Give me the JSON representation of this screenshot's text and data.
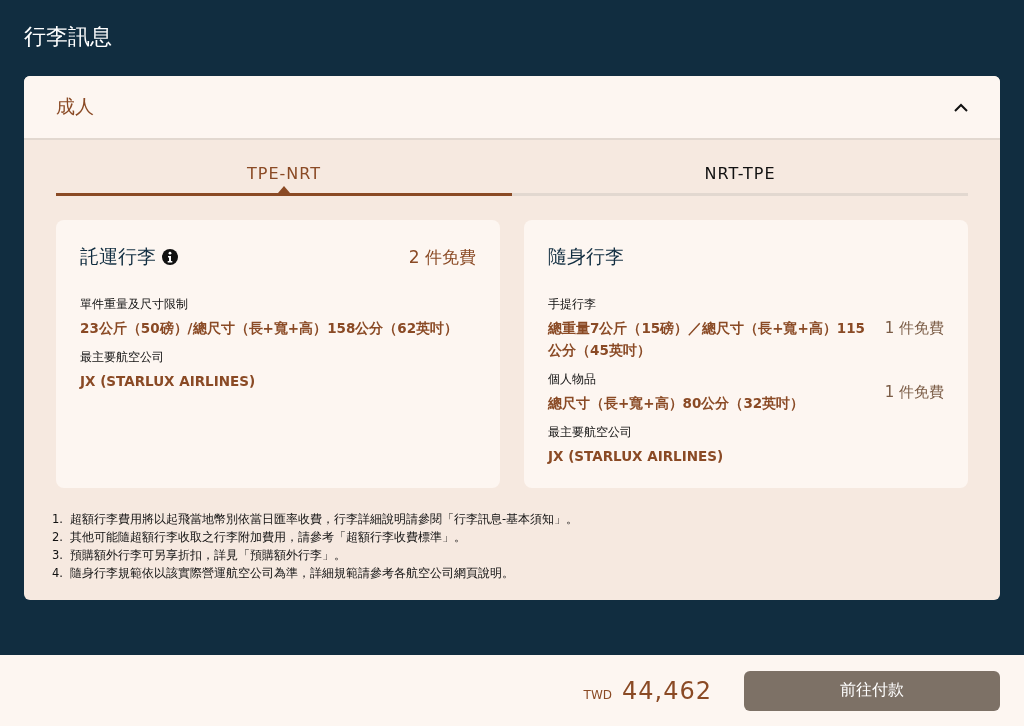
{
  "page_title": "行李訊息",
  "section": {
    "label": "成人",
    "expanded": true
  },
  "tabs": [
    {
      "label": "TPE-NRT",
      "selected": true
    },
    {
      "label": "NRT-TPE",
      "selected": false
    }
  ],
  "cards": [
    {
      "kind": "checked",
      "title": "託運行李",
      "allowance": "2 件免費",
      "items": [
        {
          "label": "單件重量及尺寸限制",
          "value": "23公斤（50磅）/總尺寸（長+寬+高）158公分（62英吋）"
        },
        {
          "label": "最主要航空公司",
          "value": "JX (STARLUX AIRLINES)"
        }
      ]
    },
    {
      "kind": "carry_on",
      "title": "隨身行李",
      "items": [
        {
          "label": "手提行李",
          "value": "總重量7公斤（15磅）／總尺寸（長+寬+高）115公分（45英吋）",
          "allowance": "1 件免費"
        },
        {
          "label": "個人物品",
          "value": "總尺寸（長+寬+高）80公分（32英吋）",
          "allowance": "1 件免費"
        },
        {
          "label": "最主要航空公司",
          "value": "JX (STARLUX AIRLINES)"
        }
      ]
    }
  ],
  "notes": [
    {
      "number": "1.",
      "text": "超額行李費用將以起飛當地幣別依當日匯率收費，行李詳細說明請參閱「行李訊息-基本須知」。"
    },
    {
      "number": "2.",
      "text": "其他可能隨超額行李收取之行李附加費用，請參考「超額行李收費標準」。"
    },
    {
      "number": "3.",
      "text": "預購額外行李可另享折扣，詳見「預購額外行李」。"
    },
    {
      "number": "4.",
      "text": "隨身行李規範依以該實際營運航空公司為準，詳細規範請參考各航空公司網頁說明。"
    }
  ],
  "footer": {
    "currency": "TWD",
    "amount": "44,462",
    "button": "前往付款"
  }
}
